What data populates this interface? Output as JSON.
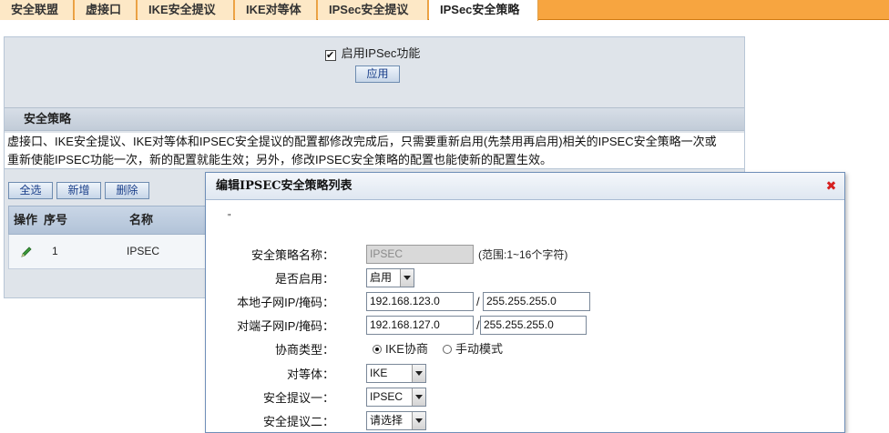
{
  "tabs": [
    {
      "label": "安全联盟",
      "active": false
    },
    {
      "label": "虚接口",
      "active": false
    },
    {
      "label": "IKE安全提议",
      "active": false
    },
    {
      "label": "IKE对等体",
      "active": false
    },
    {
      "label": "IPSec安全提议",
      "active": false
    },
    {
      "label": "IPSec安全策略",
      "active": true
    }
  ],
  "enable": {
    "checked": true,
    "label": "启用IPSec功能",
    "apply_label": "应用"
  },
  "section": {
    "title": "安全策略"
  },
  "notice": {
    "line1": "虚接口、IKE安全提议、IKE对等体和IPSEC安全提议的配置都修改完成后，只需要重新启用(先禁用再启用)相关的IPSEC安全策略一次或",
    "line2": "重新使能IPSEC功能一次，新的配置就能生效；另外，修改IPSEC安全策略的配置也能使新的配置生效。"
  },
  "actions": {
    "select_all": "全选",
    "add": "新增",
    "delete": "删除"
  },
  "table": {
    "headers": {
      "op": "操作",
      "seq": "序号",
      "name": "名称"
    },
    "rows": [
      {
        "seq": "1",
        "name": "IPSEC",
        "op_icon": "edit-pencil-icon"
      }
    ]
  },
  "dialog": {
    "title": "编辑IPSEC安全策略列表",
    "dot": "\"",
    "fields": {
      "name": {
        "label": "安全策略名称：",
        "value": "IPSEC",
        "hint": "(范围:1~16个字符)"
      },
      "enabled": {
        "label": "是否启用：",
        "value": "启用"
      },
      "local": {
        "label": "本地子网IP/掩码：",
        "ip": "192.168.123.0",
        "mask": "255.255.255.0"
      },
      "remote": {
        "label": "对端子网IP/掩码：",
        "ip": "192.168.127.0",
        "mask": "255.255.255.0"
      },
      "negotiation": {
        "label": "协商类型：",
        "option_ike": "IKE协商",
        "option_manual": "手动模式",
        "selected": "IKE协商"
      },
      "peer": {
        "label": "对等体：",
        "value": "IKE"
      },
      "proposal1": {
        "label": "安全提议一：",
        "value": "IPSEC"
      },
      "proposal2": {
        "label": "安全提议二：",
        "value": "请选择"
      }
    },
    "close_icon": "close-x-icon"
  },
  "colors": {
    "tabbar": "#f7a540",
    "panel": "#dfe4ea",
    "button_text": "#1a3f8a",
    "close": "#d62020"
  }
}
